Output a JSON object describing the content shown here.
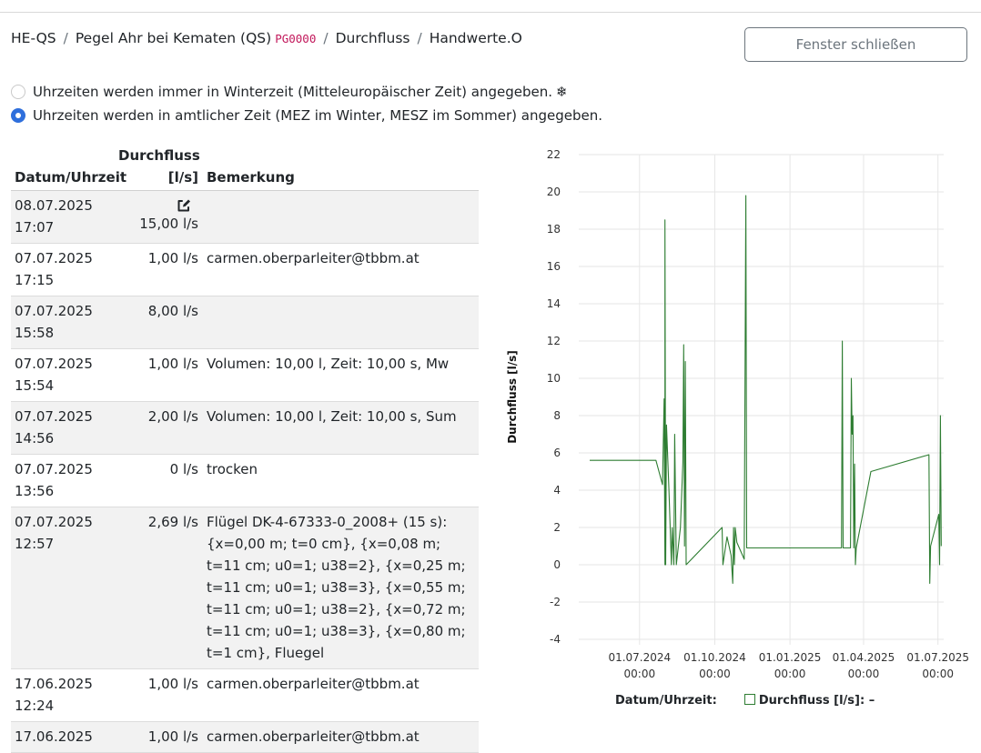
{
  "breadcrumb": {
    "items": [
      "HE-QS",
      "Pegel Ahr bei Kematen (QS)",
      "Durchfluss",
      "Handwerte.O"
    ],
    "station_code": "PG0000"
  },
  "close_button": "Fenster schließen",
  "time_options": [
    {
      "label": "Uhrzeiten werden immer in Winterzeit (Mitteleuropäischer Zeit) angegeben.",
      "selected": false,
      "icon": "snowflake-icon"
    },
    {
      "label": "Uhrzeiten werden in amtlicher Zeit (MEZ im Winter, MESZ im Sommer) angegeben.",
      "selected": true
    }
  ],
  "snowflake_glyph": "❄",
  "table": {
    "headers": {
      "datetime": "Datum/Uhrzeit",
      "flow_line1": "Durchfluss",
      "flow_line2": "[l/s]",
      "remark": "Bemerkung"
    },
    "rows": [
      {
        "date": "08.07.2025",
        "time": "17:07",
        "flow": "15,00 l/s",
        "remark": "",
        "editable": true
      },
      {
        "date": "07.07.2025",
        "time": "17:15",
        "flow": "1,00 l/s",
        "remark": "carmen.oberparleiter@tbbm.at"
      },
      {
        "date": "07.07.2025",
        "time": "15:58",
        "flow": "8,00 l/s",
        "remark": ""
      },
      {
        "date": "07.07.2025",
        "time": "15:54",
        "flow": "1,00 l/s",
        "remark": "Volumen: 10,00 l, Zeit: 10,00 s, Mw"
      },
      {
        "date": "07.07.2025",
        "time": "14:56",
        "flow": "2,00 l/s",
        "remark": "Volumen: 10,00 l, Zeit: 10,00 s, Sum"
      },
      {
        "date": "07.07.2025",
        "time": "13:56",
        "flow": "0 l/s",
        "remark": "trocken"
      },
      {
        "date": "07.07.2025",
        "time": "12:57",
        "flow": "2,69 l/s",
        "remark": "Flügel DK-4-67333-0_2008+ (15 s): {x=0,00 m; t=0 cm}, {x=0,08 m; t=11 cm; u0=1; u38=2}, {x=0,25 m; t=11 cm; u0=1; u38=3}, {x=0,55 m; t=11 cm; u0=1; u38=2}, {x=0,72 m; t=11 cm; u0=1; u38=3}, {x=0,80 m; t=1 cm}, Fluegel"
      },
      {
        "date": "17.06.2025",
        "time": "12:24",
        "flow": "1,00 l/s",
        "remark": "carmen.oberparleiter@tbbm.at"
      },
      {
        "date": "17.06.2025",
        "time": "",
        "flow": "1,00 l/s",
        "remark": "carmen.oberparleiter@tbbm.at"
      }
    ]
  },
  "chart_data": {
    "type": "line",
    "ylabel": "Durchfluss [l/s]",
    "ylim": [
      -4,
      22
    ],
    "yticks": [
      -4,
      -2,
      0,
      2,
      4,
      6,
      8,
      10,
      12,
      14,
      16,
      18,
      20,
      22
    ],
    "xlim": [
      "2024-05-01",
      "2025-07-08"
    ],
    "xticks": [
      {
        "date": "2024-07-01",
        "label1": "01.07.2024",
        "label2": "00:00"
      },
      {
        "date": "2024-10-01",
        "label1": "01.10.2024",
        "label2": "00:00"
      },
      {
        "date": "2025-01-01",
        "label1": "01.01.2025",
        "label2": "00:00"
      },
      {
        "date": "2025-04-01",
        "label1": "01.04.2025",
        "label2": "00:00"
      },
      {
        "date": "2025-07-01",
        "label1": "01.07.2025",
        "label2": "00:00"
      }
    ],
    "grid": true,
    "series_color": "#2e7d32",
    "series": [
      {
        "name": "Durchfluss [l/s]",
        "points": [
          [
            "2024-05-01",
            5.6
          ],
          [
            "2024-07-21",
            5.6
          ],
          [
            "2024-07-29",
            4.3
          ],
          [
            "2024-07-31",
            8.9
          ],
          [
            "2024-08-01",
            0
          ],
          [
            "2024-08-01",
            18.5
          ],
          [
            "2024-08-02",
            0
          ],
          [
            "2024-08-03",
            7.5
          ],
          [
            "2024-08-06",
            4.0
          ],
          [
            "2024-08-09",
            0
          ],
          [
            "2024-08-10",
            2.0
          ],
          [
            "2024-08-12",
            0
          ],
          [
            "2024-08-13",
            7.0
          ],
          [
            "2024-08-15",
            0
          ],
          [
            "2024-08-20",
            2.0
          ],
          [
            "2024-08-23",
            5.5
          ],
          [
            "2024-08-24",
            11.8
          ],
          [
            "2024-08-25",
            1.0
          ],
          [
            "2024-08-26",
            10.9
          ],
          [
            "2024-08-27",
            0
          ],
          [
            "2024-10-10",
            2.0
          ],
          [
            "2024-10-11",
            0
          ],
          [
            "2024-10-16",
            1.5
          ],
          [
            "2024-10-21",
            0.5
          ],
          [
            "2024-10-23",
            -1.0
          ],
          [
            "2024-10-24",
            2.0
          ],
          [
            "2024-10-25",
            0
          ],
          [
            "2024-10-26",
            2.0
          ],
          [
            "2024-10-28",
            1.2
          ],
          [
            "2024-11-06",
            0.3
          ],
          [
            "2024-11-08",
            19.8
          ],
          [
            "2024-11-09",
            0.9
          ],
          [
            "2025-03-05",
            0.9
          ],
          [
            "2025-03-06",
            12.0
          ],
          [
            "2025-03-07",
            0.9
          ],
          [
            "2025-03-16",
            0.9
          ],
          [
            "2025-03-17",
            10.0
          ],
          [
            "2025-03-18",
            7.0
          ],
          [
            "2025-03-19",
            8.0
          ],
          [
            "2025-03-20",
            0.9
          ],
          [
            "2025-03-21",
            5.4
          ],
          [
            "2025-03-22",
            0
          ],
          [
            "2025-03-23",
            0.9
          ],
          [
            "2025-04-10",
            5.0
          ],
          [
            "2025-06-20",
            5.9
          ],
          [
            "2025-06-21",
            -1.0
          ],
          [
            "2025-06-22",
            1.0
          ],
          [
            "2025-07-02",
            2.7
          ],
          [
            "2025-07-03",
            0
          ],
          [
            "2025-07-04",
            8.0
          ],
          [
            "2025-07-05",
            1.0
          ]
        ]
      }
    ],
    "legend": {
      "datetime_label": "Datum/Uhrzeit:",
      "series_label": "Durchfluss [l/s]:",
      "series_value": "–"
    }
  }
}
